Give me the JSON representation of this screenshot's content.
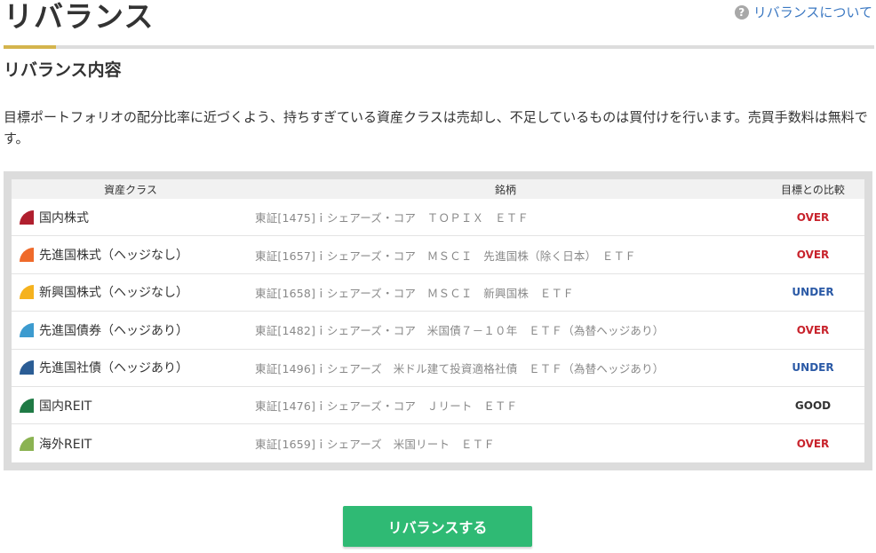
{
  "header": {
    "title": "リバランス",
    "help_link": "リバランスについて",
    "help_icon_glyph": "?"
  },
  "section": {
    "heading": "リバランス内容",
    "description": "目標ポートフォリオの配分比率に近づくよう、持ちすぎている資産クラスは売却し、不足しているものは買付けを行います。売買手数料は無料です。"
  },
  "table": {
    "columns": {
      "asset_class": "資産クラス",
      "fund": "銘柄",
      "comparison": "目標との比較"
    },
    "rows": [
      {
        "asset_class": "国内株式",
        "fund": "東証[1475]ｉシェアーズ・コア　ＴＯＰＩＸ　ＥＴＦ",
        "comparison": "OVER",
        "swatch_color": "#b01f2e",
        "status_color": "#c8232c"
      },
      {
        "asset_class": "先進国株式（ヘッジなし）",
        "fund": "東証[1657]ｉシェアーズ・コア　ＭＳＣＩ　先進国株（除く日本）　ＥＴＦ",
        "comparison": "OVER",
        "swatch_color": "#ef6a2a",
        "status_color": "#c8232c"
      },
      {
        "asset_class": "新興国株式（ヘッジなし）",
        "fund": "東証[1658]ｉシェアーズ・コア　ＭＳＣＩ　新興国株　ＥＴＦ",
        "comparison": "UNDER",
        "swatch_color": "#f5b21e",
        "status_color": "#2b5aa6"
      },
      {
        "asset_class": "先進国債券（ヘッジあり）",
        "fund": "東証[1482]ｉシェアーズ・コア　米国債７－１０年　ＥＴＦ（為替ヘッジあり）",
        "comparison": "OVER",
        "swatch_color": "#3c9bcf",
        "status_color": "#c8232c"
      },
      {
        "asset_class": "先進国社債（ヘッジあり）",
        "fund": "東証[1496]ｉシェアーズ　米ドル建て投資適格社債　ＥＴＦ（為替ヘッジあり）",
        "comparison": "UNDER",
        "swatch_color": "#2b5d95",
        "status_color": "#2b5aa6"
      },
      {
        "asset_class": "国内REIT",
        "fund": "東証[1476]ｉシェアーズ・コア　Ｊリート　ＥＴＦ",
        "comparison": "GOOD",
        "swatch_color": "#1f7a45",
        "status_color": "#333333"
      },
      {
        "asset_class": "海外REIT",
        "fund": "東証[1659]ｉシェアーズ　米国リート　ＥＴＦ",
        "comparison": "OVER",
        "swatch_color": "#8bb352",
        "status_color": "#c8232c"
      }
    ]
  },
  "actions": {
    "rebalance_button": "リバランスする",
    "button_color": "#2fba74"
  }
}
